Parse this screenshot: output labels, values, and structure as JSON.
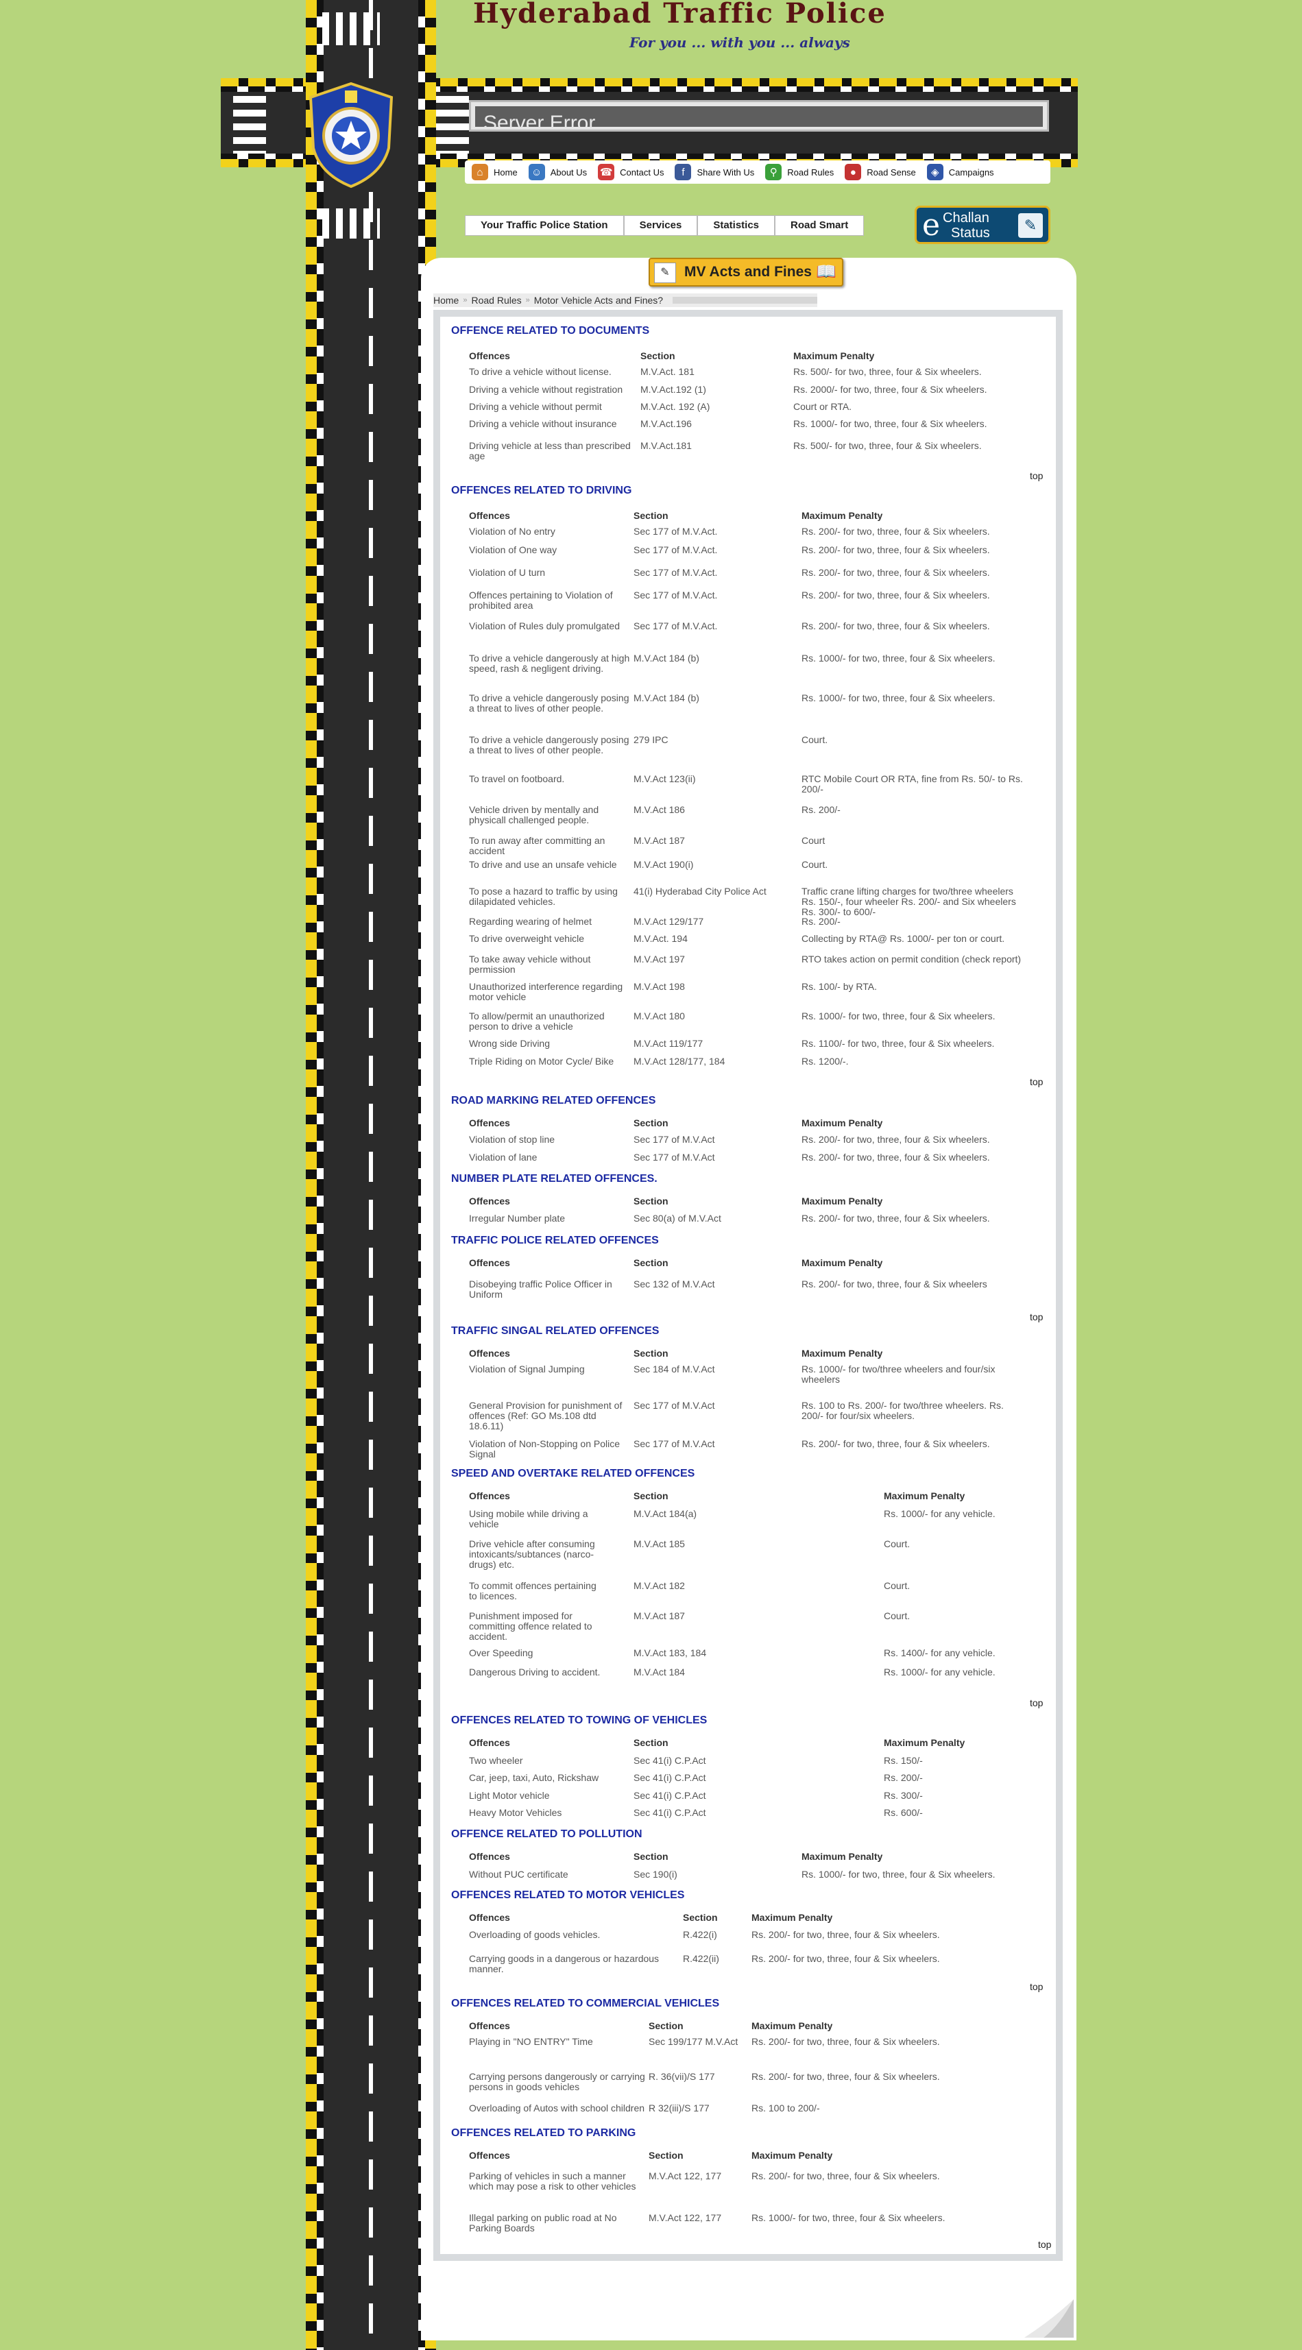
{
  "header": {
    "site_title": "Hyderabad Traffic Police",
    "tagline": "For you ... with you ... always",
    "error_text": "Server Error"
  },
  "badge": {
    "top_text": "TRAFFIC POLICE",
    "bottom_text": "HYDERABAD CITY"
  },
  "topnav": [
    {
      "label": "Home",
      "icon": "home-icon",
      "color": "#d9822b"
    },
    {
      "label": "About Us",
      "icon": "people-icon",
      "color": "#3a78c2"
    },
    {
      "label": "Contact Us",
      "icon": "phone-icon",
      "color": "#d23c3c"
    },
    {
      "label": "Share With Us",
      "icon": "facebook-icon",
      "color": "#3b5998"
    },
    {
      "label": "Road Rules",
      "icon": "bike-icon",
      "color": "#3aa03a"
    },
    {
      "label": "Road Sense",
      "icon": "car-icon",
      "color": "#c43232"
    },
    {
      "label": "Campaigns",
      "icon": "megaphone-icon",
      "color": "#2f56a8"
    }
  ],
  "secnav": [
    "Your Traffic Police Station",
    "Services",
    "Statistics",
    "Road Smart"
  ],
  "echallan": {
    "e": "e",
    "line1": "Challan",
    "line2": "Status"
  },
  "mv_banner": "MV Acts and Fines",
  "breadcrumb": [
    "Home",
    "Road Rules",
    "Motor Vehicle Acts and Fines?"
  ],
  "top_label": "top",
  "sections": [
    {
      "title": "OFFENCE RELATED TO DOCUMENTS",
      "headers": [
        "Offences",
        "Section",
        "Maximum Penalty"
      ],
      "rows": [
        [
          "To drive a vehicle without license.",
          "M.V.Act. 181",
          "Rs. 500/- for two, three, four & Six wheelers."
        ],
        [
          "Driving a vehicle without registration",
          "M.V.Act.192 (1)",
          "Rs. 2000/- for two, three, four & Six wheelers."
        ],
        [
          "Driving a vehicle without permit",
          "M.V.Act. 192 (A)",
          "Court or RTA."
        ],
        [
          "Driving a vehicle without insurance",
          "M.V.Act.196",
          "Rs. 1000/- for two, three, four & Six wheelers."
        ],
        [
          "Driving vehicle at less than prescribed age",
          "M.V.Act.181",
          "Rs. 500/- for two, three, four & Six wheelers."
        ]
      ]
    },
    {
      "title": "OFFENCES RELATED TO DRIVING",
      "headers": [
        "Offences",
        "Section",
        "Maximum Penalty"
      ],
      "rows": [
        [
          "Violation of No entry",
          "Sec 177 of M.V.Act.",
          "Rs. 200/- for two, three, four & Six wheelers."
        ],
        [
          "Violation of One way",
          "Sec 177 of M.V.Act.",
          "Rs. 200/- for two, three, four & Six wheelers."
        ],
        [
          "Violation of U turn",
          "Sec 177 of M.V.Act.",
          "Rs. 200/- for two, three, four & Six wheelers."
        ],
        [
          "Offences pertaining to Violation of prohibited area",
          "Sec 177 of M.V.Act.",
          "Rs. 200/- for two, three, four & Six wheelers."
        ],
        [
          "Violation of Rules duly promulgated",
          "Sec 177 of M.V.Act.",
          "Rs. 200/- for two, three, four & Six wheelers."
        ],
        [
          "To drive a vehicle dangerously at high speed, rash & negligent driving.",
          "M.V.Act 184 (b)",
          "Rs. 1000/- for two, three, four & Six wheelers."
        ],
        [
          "To drive a vehicle dangerously posing a threat to lives of other people.",
          "M.V.Act 184 (b)",
          "Rs. 1000/- for two, three, four & Six wheelers."
        ],
        [
          "To drive a vehicle dangerously posing a threat to lives of other people.",
          "279 IPC",
          "Court."
        ],
        [
          "To travel on footboard.",
          "M.V.Act 123(ii)",
          "RTC Mobile Court OR RTA, fine from Rs. 50/- to Rs. 200/-"
        ],
        [
          "Vehicle driven by mentally and physicall challenged people.",
          "M.V.Act 186",
          "Rs. 200/-"
        ],
        [
          "To run away after committing an accident",
          "M.V.Act 187",
          "Court"
        ],
        [
          "To drive and use an unsafe vehicle",
          "M.V.Act 190(i)",
          "Court."
        ],
        [
          "To pose a hazard to traffic by using dilapidated vehicles.",
          "41(i) Hyderabad City Police Act",
          "Traffic crane lifting charges for two/three wheelers Rs. 150/-, four wheeler Rs. 200/- and Six wheelers Rs. 300/- to 600/-"
        ],
        [
          "Regarding wearing of helmet",
          "M.V.Act 129/177",
          "Rs. 200/-"
        ],
        [
          "To drive overweight vehicle",
          "M.V.Act. 194",
          "Collecting by RTA@ Rs. 1000/- per ton or court."
        ],
        [
          "To take away vehicle without permission",
          "M.V.Act 197",
          "RTO takes action on permit condition (check report)"
        ],
        [
          "Unauthorized interference regarding motor vehicle",
          "M.V.Act 198",
          "Rs. 100/- by RTA."
        ],
        [
          "To allow/permit an unauthorized person to drive a vehicle",
          "M.V.Act 180",
          "Rs. 1000/- for two, three, four & Six wheelers."
        ],
        [
          "Wrong side  Driving",
          "M.V.Act 119/177",
          "Rs. 1100/- for two, three, four & Six wheelers."
        ],
        [
          "Triple Riding on Motor Cycle/ Bike",
          "M.V.Act 128/177, 184",
          "Rs. 1200/-."
        ]
      ]
    },
    {
      "title": "ROAD MARKING RELATED OFFENCES",
      "headers": [
        "Offences",
        "Section",
        "Maximum Penalty"
      ],
      "rows": [
        [
          "Violation of stop line",
          "Sec 177 of M.V.Act",
          "Rs. 200/- for two, three, four & Six wheelers."
        ],
        [
          "Violation of lane",
          "Sec 177 of M.V.Act",
          "Rs. 200/- for two, three, four & Six wheelers."
        ]
      ]
    },
    {
      "title": "NUMBER PLATE RELATED OFFENCES.",
      "headers": [
        "Offences",
        "Section",
        "Maximum Penalty"
      ],
      "rows": [
        [
          "Irregular Number plate",
          "Sec 80(a) of M.V.Act",
          "Rs. 200/- for two, three, four & Six wheelers."
        ]
      ]
    },
    {
      "title": "TRAFFIC POLICE RELATED OFFENCES",
      "headers": [
        "Offences",
        "Section",
        "Maximum Penalty"
      ],
      "rows": [
        [
          "Disobeying traffic Police Officer in Uniform",
          "Sec 132 of M.V.Act",
          "Rs. 200/- for two, three, four & Six wheelers"
        ]
      ]
    },
    {
      "title": "TRAFFIC SINGAL RELATED OFFENCES",
      "headers": [
        "Offences",
        "Section",
        "Maximum Penalty"
      ],
      "rows": [
        [
          "Violation of Signal Jumping",
          "Sec 184 of M.V.Act",
          "Rs. 1000/-  for two/three wheelers and four/six wheelers"
        ],
        [
          "General Provision for punishment of  offences (Ref: GO Ms.108 dtd 18.6.11)",
          "Sec 177 of M.V.Act",
          "Rs. 100 to Rs. 200/- for two/three wheelers. Rs. 200/- for four/six wheelers."
        ],
        [
          "Violation of Non-Stopping on Police Signal",
          "Sec 177 of M.V.Act",
          "Rs. 200/- for two, three, four & Six wheelers."
        ]
      ]
    },
    {
      "title": "SPEED AND OVERTAKE RELATED OFFENCES",
      "headers": [
        "Offences",
        "Section",
        "Maximum Penalty"
      ],
      "rows": [
        [
          "Using mobile while driving a vehicle",
          "M.V.Act 184(a)",
          "Rs. 1000/- for any vehicle."
        ],
        [
          "Drive vehicle after consuming intoxicants/subtances (narco-drugs) etc.",
          "M.V.Act 185",
          "Court."
        ],
        [
          "To commit offences pertaining to licences.",
          "M.V.Act 182",
          "Court."
        ],
        [
          "Punishment imposed for committing offence related to accident.",
          "M.V.Act 187",
          "Court."
        ],
        [
          "Over Speeding",
          "M.V.Act 183, 184",
          "Rs. 1400/- for any vehicle."
        ],
        [
          "Dangerous Driving to accident.",
          "M.V.Act 184",
          "Rs. 1000/- for any vehicle."
        ]
      ]
    },
    {
      "title": "OFFENCES RELATED TO TOWING OF VEHICLES",
      "headers": [
        "Offences",
        "Section",
        "Maximum Penalty"
      ],
      "rows": [
        [
          "Two wheeler",
          "Sec 41(i) C.P.Act",
          "Rs. 150/-"
        ],
        [
          "Car, jeep, taxi, Auto, Rickshaw",
          "Sec 41(i) C.P.Act",
          "Rs. 200/-"
        ],
        [
          "Light Motor vehicle",
          "Sec 41(i) C.P.Act",
          "Rs. 300/-"
        ],
        [
          "Heavy Motor Vehicles",
          "Sec 41(i) C.P.Act",
          "Rs. 600/-"
        ]
      ]
    },
    {
      "title": "OFFENCE RELATED TO POLLUTION",
      "headers": [
        "Offences",
        "Section",
        "Maximum Penalty"
      ],
      "rows": [
        [
          "Without PUC certificate",
          "Sec 190(i)",
          "Rs. 1000/- for two, three, four & Six wheelers."
        ]
      ]
    },
    {
      "title": "OFFENCES RELATED TO MOTOR VEHICLES",
      "headers": [
        "Offences",
        "Section",
        "Maximum Penalty"
      ],
      "rows": [
        [
          "Overloading of goods vehicles.",
          "R.422(i)",
          "Rs. 200/- for two, three, four & Six wheelers."
        ],
        [
          "Carrying goods in a dangerous or hazardous manner.",
          "R.422(ii)",
          "Rs. 200/- for two, three, four & Six wheelers."
        ]
      ]
    },
    {
      "title": "OFFENCES RELATED TO COMMERCIAL VEHICLES",
      "headers": [
        "Offences",
        "Section",
        "Maximum Penalty"
      ],
      "rows": [
        [
          "Playing in \"NO ENTRY\" Time",
          "Sec 199/177 M.V.Act",
          "Rs. 200/- for two, three, four & Six wheelers."
        ],
        [
          "Carrying persons dangerously or carrying persons in goods vehicles",
          "R. 36(vii)/S 177",
          "Rs. 200/- for two, three, four & Six wheelers."
        ],
        [
          "Overloading of Autos with school children",
          "R 32(iii)/S 177",
          "Rs. 100 to 200/-"
        ]
      ]
    },
    {
      "title": "OFFENCES RELATED TO PARKING",
      "headers": [
        "Offences",
        "Section",
        "Maximum Penalty"
      ],
      "rows": [
        [
          "Parking of vehicles in such a manner which may pose a risk to other vehicles",
          "M.V.Act 122, 177",
          "Rs. 200/- for two, three, four & Six wheelers."
        ],
        [
          "Illegal parking on public road at No Parking Boards",
          "M.V.Act 122, 177",
          "Rs. 1000/- for two, three, four & Six wheelers."
        ]
      ]
    }
  ]
}
